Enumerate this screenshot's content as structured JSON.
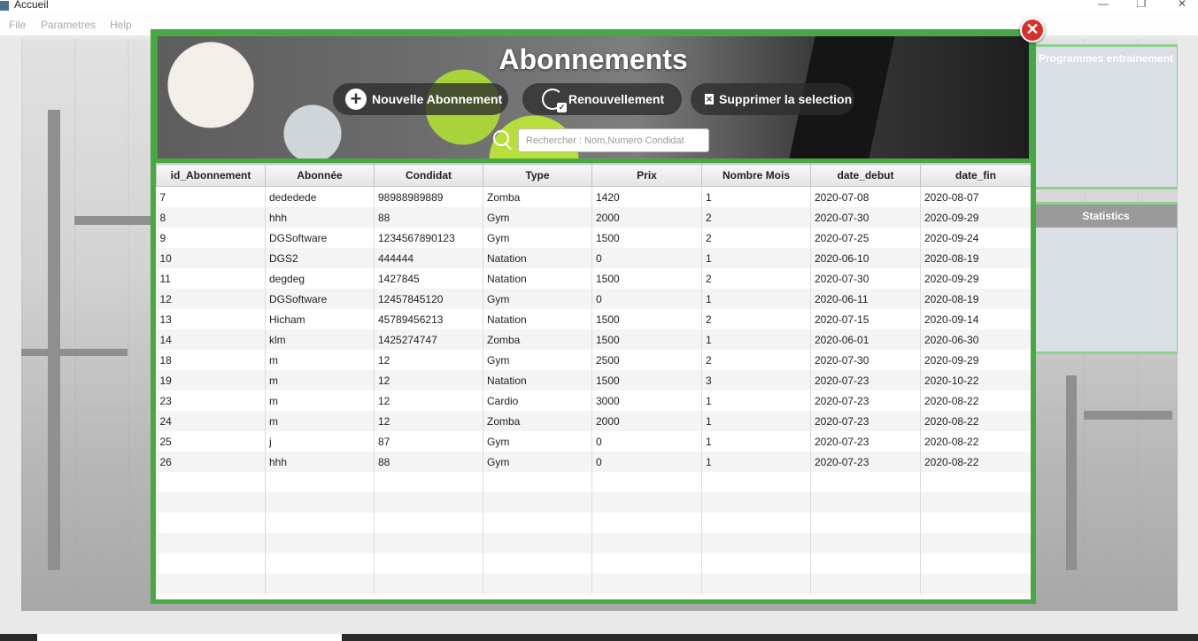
{
  "window": {
    "title": "Accueil",
    "menu": [
      "File",
      "Parametres",
      "Help"
    ],
    "controls": {
      "minimize": "—",
      "maximize": "❐",
      "close": "✕"
    }
  },
  "background": {
    "cards": [
      {
        "title": "Programmes entrainement"
      },
      {
        "title": "Statistics"
      }
    ]
  },
  "dialog": {
    "title": "Abonnements",
    "close_symbol": "✕",
    "toolbar": {
      "new_label": "Nouvelle Abonnement",
      "renew_label": "Renouvellement",
      "delete_label": "Supprimer la selection"
    },
    "search": {
      "placeholder": "Rechercher : Nom,Numero Condidat"
    },
    "table": {
      "columns": [
        "id_Abonnement",
        "Abonnée",
        "Condidat",
        "Type",
        "Prix",
        "Nombre Mois",
        "date_debut",
        "date_fin"
      ],
      "rows": [
        [
          "7",
          "dededede",
          "98988989889",
          "Zomba",
          "1420",
          "1",
          "2020-07-08",
          "2020-08-07"
        ],
        [
          "8",
          "hhh",
          "88",
          "Gym",
          "2000",
          "2",
          "2020-07-30",
          "2020-09-29"
        ],
        [
          "9",
          "DGSoftware",
          "1234567890123",
          "Gym",
          "1500",
          "2",
          "2020-07-25",
          "2020-09-24"
        ],
        [
          "10",
          "DGS2",
          "444444",
          "Natation",
          "0",
          "1",
          "2020-06-10",
          "2020-08-19"
        ],
        [
          "11",
          "degdeg",
          "1427845",
          "Natation",
          "1500",
          "2",
          "2020-07-30",
          "2020-09-29"
        ],
        [
          "12",
          "DGSoftware",
          "12457845120",
          "Gym",
          "0",
          "1",
          "2020-06-11",
          "2020-08-19"
        ],
        [
          "13",
          "Hicham",
          "45789456213",
          "Natation",
          "1500",
          "2",
          "2020-07-15",
          "2020-09-14"
        ],
        [
          "14",
          "klm",
          "1425274747",
          "Zomba",
          "1500",
          "1",
          "2020-06-01",
          "2020-06-30"
        ],
        [
          "18",
          "m",
          "12",
          "Gym",
          "2500",
          "2",
          "2020-07-30",
          "2020-09-29"
        ],
        [
          "19",
          "m",
          "12",
          "Natation",
          "1500",
          "3",
          "2020-07-23",
          "2020-10-22"
        ],
        [
          "23",
          "m",
          "12",
          "Cardio",
          "3000",
          "1",
          "2020-07-23",
          "2020-08-22"
        ],
        [
          "24",
          "m",
          "12",
          "Zomba",
          "2000",
          "1",
          "2020-07-23",
          "2020-08-22"
        ],
        [
          "25",
          "j",
          "87",
          "Gym",
          "0",
          "1",
          "2020-07-23",
          "2020-08-22"
        ],
        [
          "26",
          "hhh",
          "88",
          "Gym",
          "0",
          "1",
          "2020-07-23",
          "2020-08-22"
        ]
      ],
      "empty_rows": 6
    }
  },
  "colors": {
    "accent_green": "#47a844",
    "close_red": "#d9302c"
  }
}
